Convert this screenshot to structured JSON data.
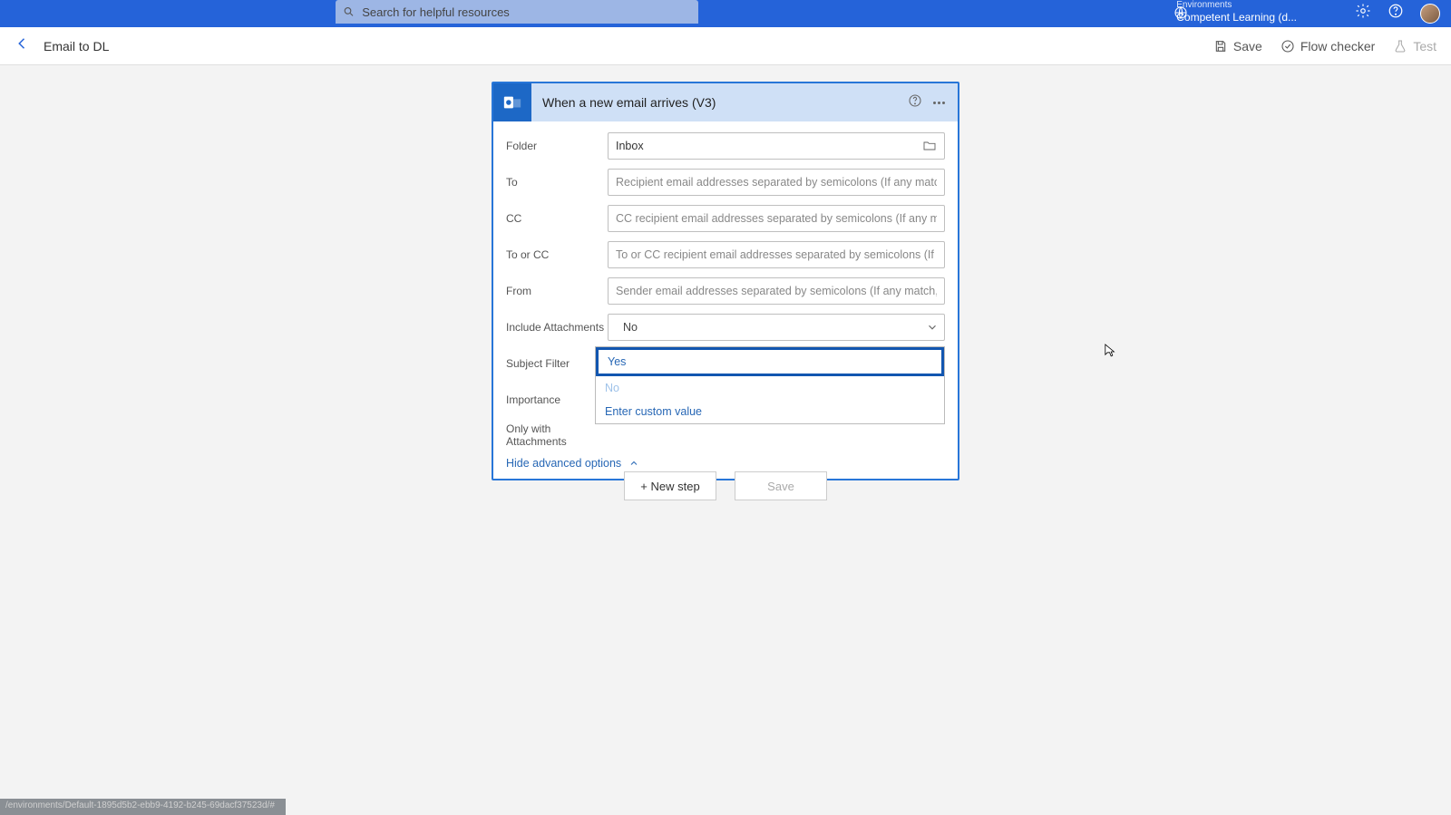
{
  "topbar": {
    "search_placeholder": "Search for helpful resources",
    "env_label": "Environments",
    "env_name": "Competent Learning (d..."
  },
  "secondbar": {
    "title": "Email to DL",
    "save": "Save",
    "flow_checker": "Flow checker",
    "test": "Test"
  },
  "card": {
    "title": "When a new email arrives (V3)",
    "fields": {
      "folder_label": "Folder",
      "folder_value": "Inbox",
      "to_label": "To",
      "to_placeholder": "Recipient email addresses separated by semicolons (If any match, the",
      "cc_label": "CC",
      "cc_placeholder": "CC recipient email addresses separated by semicolons (If any match,",
      "toorcc_label": "To or CC",
      "toorcc_placeholder": "To or CC recipient email addresses separated by semicolons (If any m",
      "from_label": "From",
      "from_placeholder": "Sender email addresses separated by semicolons (If any match, the t",
      "include_label": "Include Attachments",
      "include_value": "No",
      "subject_label": "Subject Filter",
      "importance_label": "Importance",
      "only_label": "Only with Attachments"
    },
    "dropdown": {
      "yes": "Yes",
      "no": "No",
      "custom": "Enter custom value"
    },
    "hide_adv": "Hide advanced options"
  },
  "bottom": {
    "new_step": "+ New step",
    "save": "Save"
  },
  "status": "/environments/Default-1895d5b2-ebb9-4192-b245-69dacf37523d/#"
}
